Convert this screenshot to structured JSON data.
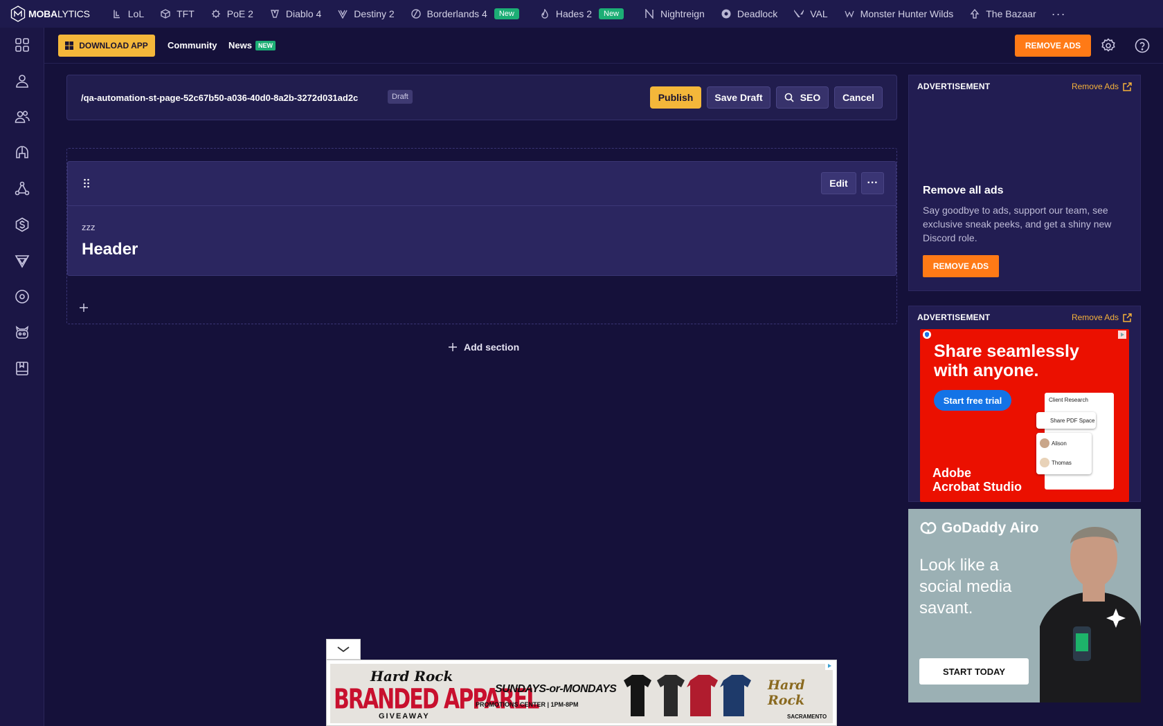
{
  "brand": {
    "logo_bold": "MOBA",
    "logo_thin": "LYTICS"
  },
  "games": [
    {
      "label": "LoL",
      "icon": "lol-icon"
    },
    {
      "label": "TFT",
      "icon": "tft-icon"
    },
    {
      "label": "PoE 2",
      "icon": "poe2-icon"
    },
    {
      "label": "Diablo 4",
      "icon": "diablo4-icon"
    },
    {
      "label": "Destiny 2",
      "icon": "destiny2-icon"
    },
    {
      "label": "Borderlands 4",
      "icon": "borderlands4-icon",
      "badge": "New"
    },
    {
      "label": "Hades 2",
      "icon": "hades2-icon",
      "badge": "New"
    },
    {
      "label": "Nightreign",
      "icon": "nightreign-icon"
    },
    {
      "label": "Deadlock",
      "icon": "deadlock-icon"
    },
    {
      "label": "VAL",
      "icon": "valorant-icon"
    },
    {
      "label": "Monster Hunter Wilds",
      "icon": "monster-hunter-icon"
    },
    {
      "label": "The Bazaar",
      "icon": "bazaar-icon"
    }
  ],
  "nav_more": "···",
  "subbar": {
    "download_label": "DOWNLOAD APP",
    "community_label": "Community",
    "news_label": "News",
    "news_badge": "NEW",
    "remove_ads_label": "REMOVE ADS"
  },
  "editor": {
    "url": "/qa-automation-st-page-52c67b50-a036-40d0-8a2b-3272d031ad2c",
    "status_badge": "Draft",
    "publish_label": "Publish",
    "save_draft_label": "Save Draft",
    "seo_label": "SEO",
    "cancel_label": "Cancel"
  },
  "block": {
    "edit_label": "Edit",
    "more_label": "···",
    "eyebrow": "zzz",
    "header": "Header"
  },
  "add_section_label": "Add section",
  "sidebar": {
    "ad_label": "ADVERTISEMENT",
    "remove_ads_link": "Remove Ads",
    "remove_all_title": "Remove all ads",
    "remove_all_desc": "Say goodbye to ads, support our team, see exclusive sneak peeks, and get a shiny new Discord role.",
    "remove_all_btn": "REMOVE ADS"
  },
  "ads": {
    "adobe": {
      "headline": "Share seamlessly with anyone.",
      "cta": "Start free trial",
      "brand_line1": "Adobe",
      "brand_line2": "Acrobat Studio",
      "doc_title": "Client Research",
      "share_label": "Share PDF Space",
      "person1": "Alison",
      "person2": "Thomas"
    },
    "godaddy": {
      "brand": "GoDaddy Airo",
      "headline": "Look like a social media savant.",
      "cta": "START TODAY"
    },
    "hardrock": {
      "logo": "Hard Rock",
      "title": "BRANDED APPAREL",
      "subtitle": "GIVEAWAY",
      "days": "SUNDAYS-or-MONDAYS",
      "promo": "PROMOTIONS CENTER | 1PM-8PM",
      "venue": "Hard Rock",
      "city": "SACRAMENTO"
    }
  },
  "colors": {
    "page_bg": "#15113a",
    "accent_yellow": "#f4b73a",
    "accent_orange": "#ff7a16",
    "badge_green": "#1cae75"
  }
}
